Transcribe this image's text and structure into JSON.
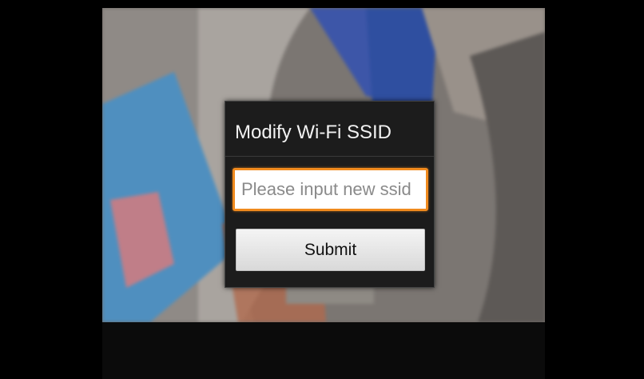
{
  "dialog": {
    "title": "Modify Wi-Fi SSID",
    "ssid_input": {
      "value": "",
      "placeholder": "Please input new ssid"
    },
    "submit_label": "Submit"
  },
  "colors": {
    "input_focus_border": "#f08a1e",
    "dialog_background": "#1c1c1c",
    "button_background": "#e6e6e6"
  }
}
